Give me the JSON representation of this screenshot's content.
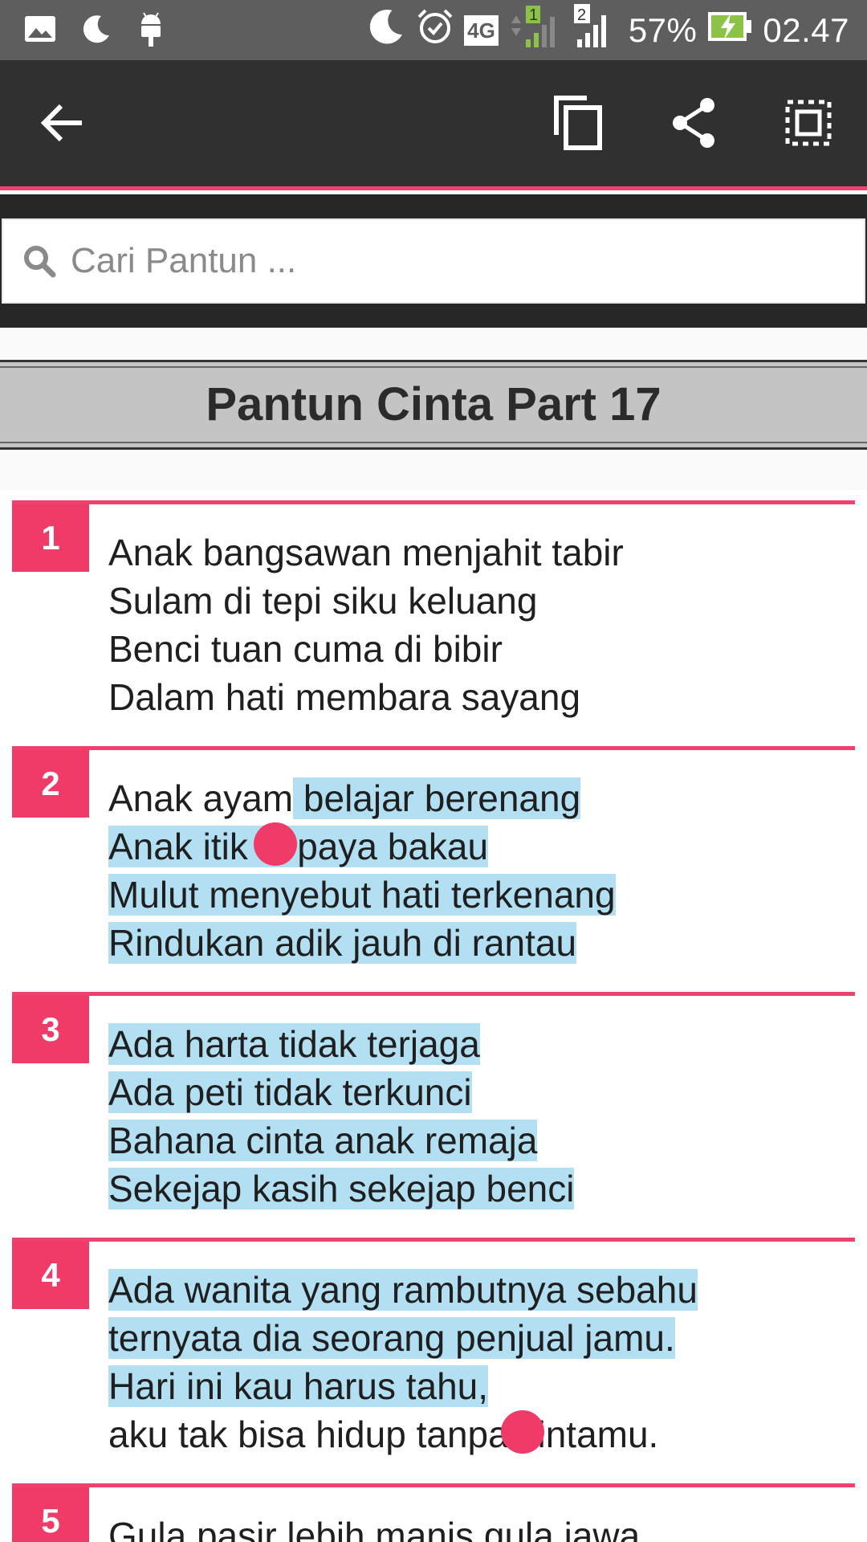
{
  "status_bar": {
    "battery_percent": "57%",
    "time": "02.47",
    "network": "4G",
    "sim1": "1",
    "sim2": "2",
    "icons": [
      "gallery-icon",
      "moon-icon",
      "android-icon",
      "moon-icon",
      "alarm-icon",
      "signal-icon",
      "battery-charging-icon"
    ]
  },
  "toolbar": {
    "icons": [
      "back-arrow-icon",
      "copy-icon",
      "share-icon",
      "select-all-icon"
    ],
    "accent": "#f0406e"
  },
  "search": {
    "placeholder": "Cari Pantun ..."
  },
  "page": {
    "title": "Pantun Cinta Part 17"
  },
  "pantun": [
    {
      "number": "1",
      "lines": [
        "Anak bangsawan menjahit tabir",
        "Sulam di tepi siku keluang",
        "Benci tuan cuma di bibir",
        "Dalam hati membara sayang"
      ]
    },
    {
      "number": "2",
      "lines": [
        "Anak ayam belajar berenang",
        "Anak itik di paya bakau",
        "Mulut menyebut hati terkenang",
        "Rindukan adik jauh di rantau"
      ]
    },
    {
      "number": "3",
      "lines": [
        "Ada harta tidak terjaga",
        "Ada peti tidak terkunci",
        "Bahana cinta anak remaja",
        "Sekejap kasih sekejap benci"
      ]
    },
    {
      "number": "4",
      "lines": [
        "Ada wanita yang rambutnya sebahu",
        "ternyata dia seorang penjual jamu.",
        "Hari ini kau harus tahu,",
        "aku tak bisa hidup tanpa cintamu."
      ]
    },
    {
      "number": "5",
      "lines": [
        "Gula pasir lebih manis gula jawa"
      ]
    }
  ],
  "colors": {
    "accent": "#f03a68",
    "selection": "#b3dff3",
    "toolbar": "#303030"
  }
}
